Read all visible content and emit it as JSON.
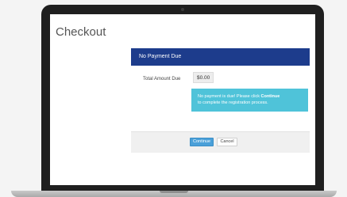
{
  "page": {
    "title": "Checkout"
  },
  "panel": {
    "header": "No Payment Due"
  },
  "amount": {
    "label": "Total Amount Due",
    "value": "$0.00"
  },
  "info": {
    "prefix": "No payment is due! Please click ",
    "emphasis": "Continue",
    "line2": "to complete the registration process."
  },
  "buttons": {
    "continue": "Continue",
    "cancel": "Cancel"
  },
  "colors": {
    "header": "#1d3c8c",
    "info": "#4fc3d9",
    "primary_button": "#4aa0d9"
  }
}
